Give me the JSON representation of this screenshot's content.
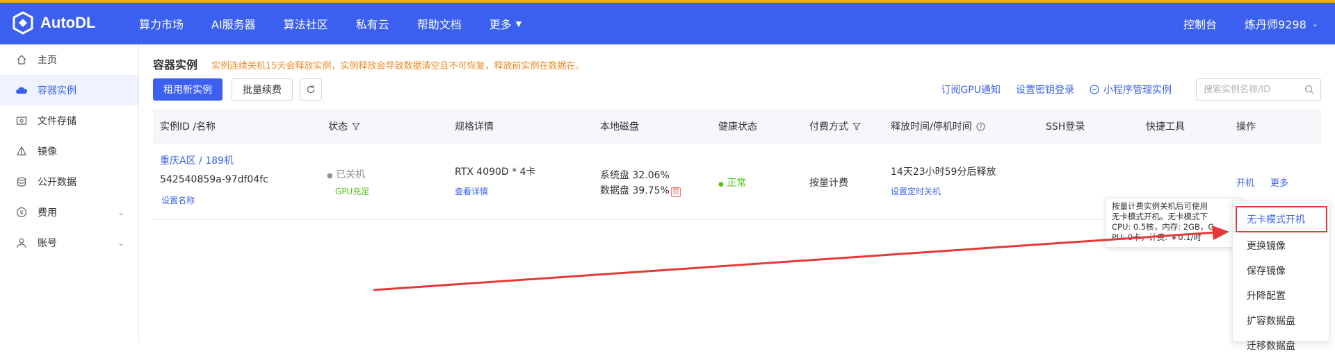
{
  "brand": {
    "name": "AutoDL"
  },
  "topnav": {
    "items": [
      "算力市场",
      "AI服务器",
      "算法社区",
      "私有云",
      "帮助文档",
      "更多"
    ],
    "console": "控制台",
    "user": "炼丹师9298"
  },
  "sidebar": {
    "items": [
      {
        "label": "主页",
        "icon": "home-icon"
      },
      {
        "label": "容器实例",
        "icon": "cloud-icon"
      },
      {
        "label": "文件存储",
        "icon": "folder-icon"
      },
      {
        "label": "镜像",
        "icon": "image-icon"
      },
      {
        "label": "公开数据",
        "icon": "database-icon"
      },
      {
        "label": "费用",
        "icon": "yen-icon"
      },
      {
        "label": "账号",
        "icon": "user-icon"
      }
    ]
  },
  "page": {
    "title": "容器实例",
    "warning": "实例连续关机15天会释放实例，实例释放会导致数据清空且不可恢复，释放前实例在数据在。"
  },
  "toolbar": {
    "rent_new": "租用新实例",
    "batch_renew": "批量续费",
    "subscribe_gpu": "订阅GPU通知",
    "set_key_login": "设置密钥登录",
    "miniprogram": "小程序管理实例",
    "search_placeholder": "搜索实例名称/ID"
  },
  "table": {
    "headers": [
      "实例ID /名称",
      "状态",
      "规格详情",
      "本地磁盘",
      "健康状态",
      "付费方式",
      "释放时间/停机时间",
      "SSH登录",
      "快捷工具",
      "操作"
    ],
    "row": {
      "region": "重庆A区 / 189机",
      "instance_id": "542540859a-97df04fc",
      "set_name": "设置名称",
      "status": "已关机",
      "gpu_status": "GPU充足",
      "spec": "RTX 4090D * 4卡",
      "spec_detail": "查看详情",
      "system_disk": "系统盘 32.06%",
      "data_disk": "数据盘 39.75%",
      "fee_tag": "费",
      "health": "正常",
      "billing": "按量计费",
      "release_time": "14天23小时59分后释放",
      "set_shutdown": "设置定时关机",
      "action_start": "开机",
      "action_more": "更多"
    }
  },
  "tooltip": {
    "lines": [
      "按量计费实例关机后可使用",
      "无卡模式开机。无卡模式下",
      "CPU: 0.5核，内存: 2GB，G",
      "PU: 0卡，计费: ￥0.1/时"
    ]
  },
  "dropdown": {
    "items": [
      "无卡模式开机",
      "更换镜像",
      "保存镜像",
      "升降配置",
      "扩容数据盘",
      "迁移数据盘"
    ]
  },
  "colors": {
    "primary": "#3b60ef",
    "warning": "#f08a24",
    "success": "#52c41a",
    "annotation": "#e53935"
  }
}
